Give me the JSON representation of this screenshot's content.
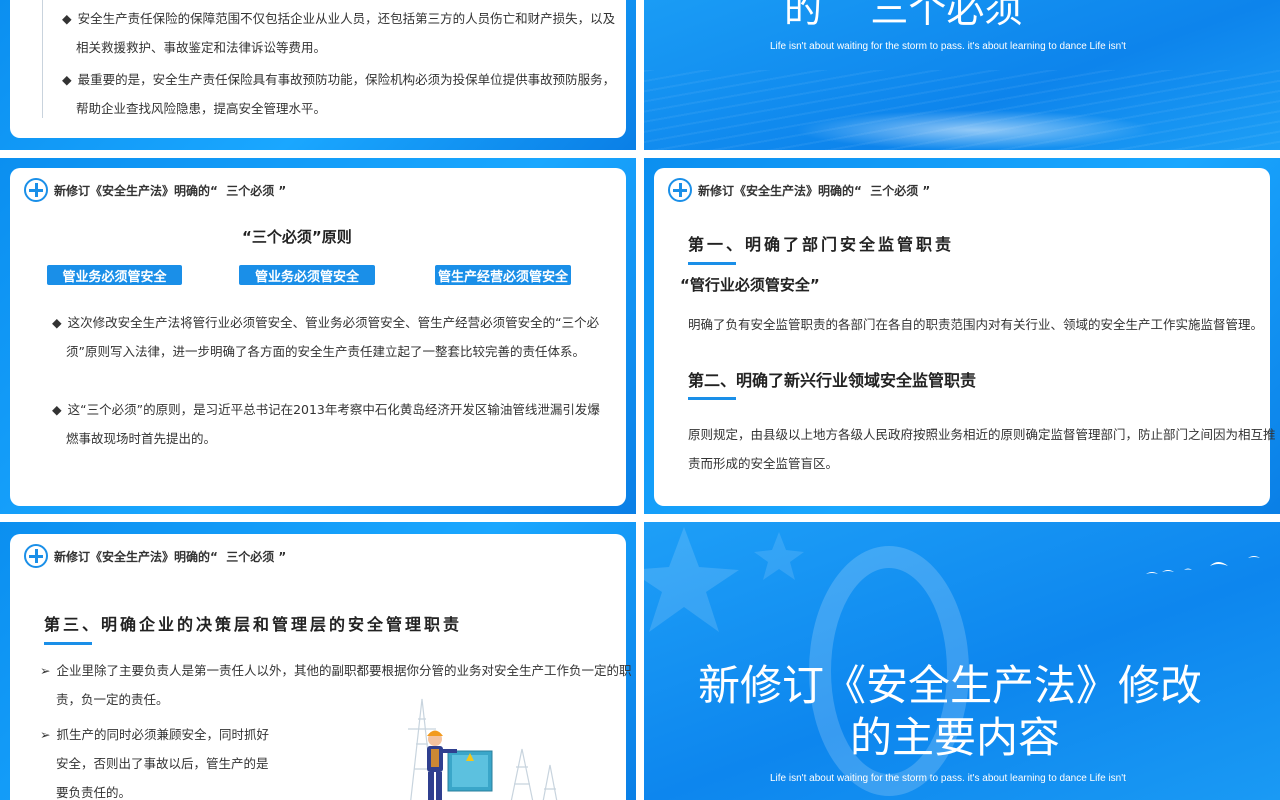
{
  "slide_tl": {
    "bullets": [
      "安全生产责任保险的保障范围不仅包括企业从业人员，还包括第三方的人员伤亡和财产损失，以及",
      "相关救援救护、事故鉴定和法律诉讼等费用。",
      "最重要的是，安全生产责任保险具有事故预防功能，保险机构必须为投保单位提供事故预防服务，",
      "帮助企业查找风险隐患，提高安全管理水平。"
    ]
  },
  "slide_tr": {
    "title_fragment": "的    三个必须",
    "english": "Life isn't about waiting for the storm to pass. it's about learning to dance Life isn't"
  },
  "header": {
    "text": "新修订《安全生产法》明确的“  三个必须 ”"
  },
  "slide_ml": {
    "principle_title": "“三个必须”原则",
    "badges": [
      "管业务必须管安全",
      "管业务必须管安全",
      "管生产经营必须管安全"
    ],
    "bullets": [
      "这次修改安全生产法将管行业必须管安全、管业务必须管安全、管生产经营必须管安全的“三个必",
      "须”原则写入法律，进一步明确了各方面的安全生产责任建立起了一整套比较完善的责任体系。",
      "这“三个必须”的原则，是习近平总书记在2013年考察中石化黄岛经济开发区输油管线泄漏引发爆",
      "燃事故现场时首先提出的。"
    ]
  },
  "slide_mr": {
    "first_title": "第一、明确了部门安全监管职责",
    "quote": "“管行业必须管安全”",
    "first_body": "明确了负有安全监管职责的各部门在各自的职责范围内对有关行业、领域的安全生产工作实施监督管理。",
    "second_title": "第二、明确了新兴行业领域安全监管职责",
    "second_body_1": "原则规定，由县级以上地方各级人民政府按照业务相近的原则确定监督管理部门，防止部门之间因为相互推",
    "second_body_2": "责而形成的安全监管盲区。"
  },
  "slide_bl": {
    "third_title": "第三、明确企业的决策层和管理层的安全管理职责",
    "bullets": [
      "企业里除了主要负责人是第一责任人以外，其他的副职都要根据你分管的业务对安全生产工作负一定的职",
      "责，负一定的责任。",
      "抓生产的同时必须兼顾安全，同时抓好",
      "安全，否则出了事故以后，管生产的是",
      "要负责任的。"
    ]
  },
  "slide_br": {
    "big_number": "0",
    "title_line1": "新修订《安全生产法》修改",
    "title_line2": "的主要内容",
    "english": "Life isn't about waiting for the storm to pass. it's about learning to dance Life isn't"
  },
  "icons": {
    "logo": "safety-cross-logo-icon",
    "bullet": "diamond-bullet-icon",
    "arrow": "arrow-bullet-icon",
    "worker": "worker-illustration-icon",
    "birds": "birds-icon",
    "star": "star-icon"
  },
  "colors": {
    "accent": "#1a8fe8",
    "frame": "#0b8ff0",
    "text": "#333333"
  }
}
